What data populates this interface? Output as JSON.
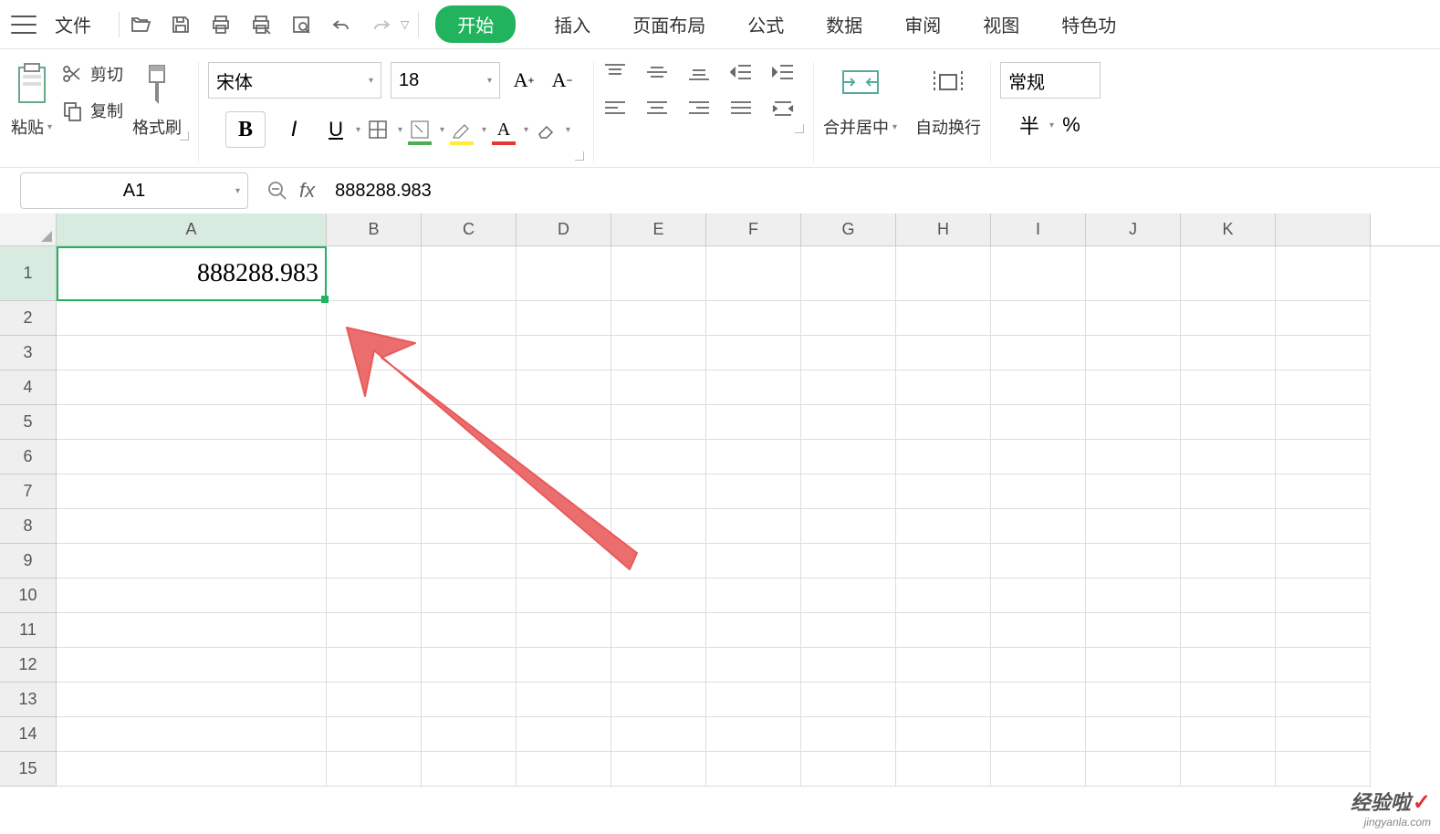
{
  "menu": {
    "file": "文件",
    "tabs": {
      "start": "开始",
      "insert": "插入",
      "page_layout": "页面布局",
      "formula": "公式",
      "data": "数据",
      "review": "审阅",
      "view": "视图",
      "special": "特色功"
    }
  },
  "ribbon": {
    "clipboard": {
      "paste": "粘贴",
      "cut": "剪切",
      "copy": "复制"
    },
    "format_painter": "格式刷",
    "font": {
      "name": "宋体",
      "size": "18",
      "bold": "B",
      "italic": "I",
      "underline": "U"
    },
    "merge": "合并居中",
    "wrap": "自动换行",
    "number_format": {
      "category": "常规",
      "currency": "半",
      "percent": "%"
    }
  },
  "formula_bar": {
    "name_box": "A1",
    "fx": "fx",
    "value": "888288.983"
  },
  "grid": {
    "columns": [
      "A",
      "B",
      "C",
      "D",
      "E",
      "F",
      "G",
      "H",
      "I",
      "J",
      "K"
    ],
    "rows": [
      "1",
      "2",
      "3",
      "4",
      "5",
      "6",
      "7",
      "8",
      "9",
      "10",
      "11",
      "12",
      "13",
      "14",
      "15"
    ],
    "active_cell_value": "888288.983"
  },
  "watermark": {
    "brand": "经验啦",
    "domain": "jingyanla.com"
  }
}
